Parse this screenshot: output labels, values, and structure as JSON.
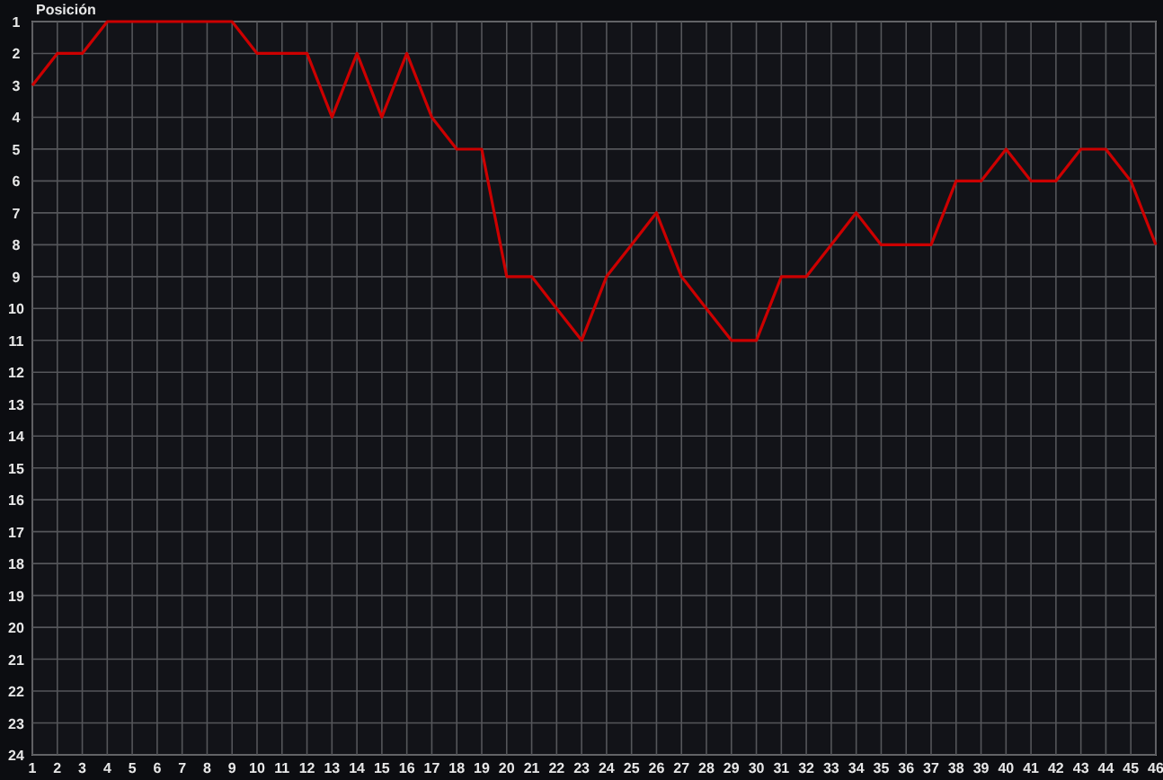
{
  "chart": {
    "chart_data": {
      "type": "line",
      "ylabel": "Posición",
      "grid": true,
      "x": [
        1,
        2,
        3,
        4,
        5,
        6,
        7,
        8,
        9,
        10,
        11,
        12,
        13,
        14,
        15,
        16,
        17,
        18,
        19,
        20,
        21,
        22,
        23,
        24,
        25,
        26,
        27,
        28,
        29,
        30,
        31,
        32,
        33,
        34,
        35,
        36,
        37,
        38,
        39,
        40,
        41,
        42,
        43,
        44,
        45,
        46
      ],
      "series": [
        {
          "color": "#cc0000",
          "values": [
            3,
            2,
            2,
            1,
            1,
            1,
            1,
            1,
            1,
            2,
            2,
            2,
            4,
            2,
            4,
            2,
            4,
            5,
            5,
            9,
            9,
            10,
            11,
            9,
            8,
            7,
            9,
            10,
            11,
            11,
            9,
            9,
            8,
            7,
            8,
            8,
            8,
            6,
            6,
            5,
            6,
            6,
            5,
            5,
            6,
            8
          ]
        }
      ],
      "xlim": [
        1,
        46
      ],
      "ylim": [
        24,
        1
      ],
      "xticks": [
        1,
        2,
        3,
        4,
        5,
        6,
        7,
        8,
        9,
        10,
        11,
        12,
        13,
        14,
        15,
        16,
        17,
        18,
        19,
        20,
        21,
        22,
        23,
        24,
        25,
        26,
        27,
        28,
        29,
        30,
        31,
        32,
        33,
        34,
        35,
        36,
        37,
        38,
        39,
        40,
        41,
        42,
        43,
        44,
        45,
        46
      ],
      "yticks": [
        1,
        2,
        3,
        4,
        5,
        6,
        7,
        8,
        9,
        10,
        11,
        12,
        13,
        14,
        15,
        16,
        17,
        18,
        19,
        20,
        21,
        22,
        23,
        24
      ]
    }
  }
}
